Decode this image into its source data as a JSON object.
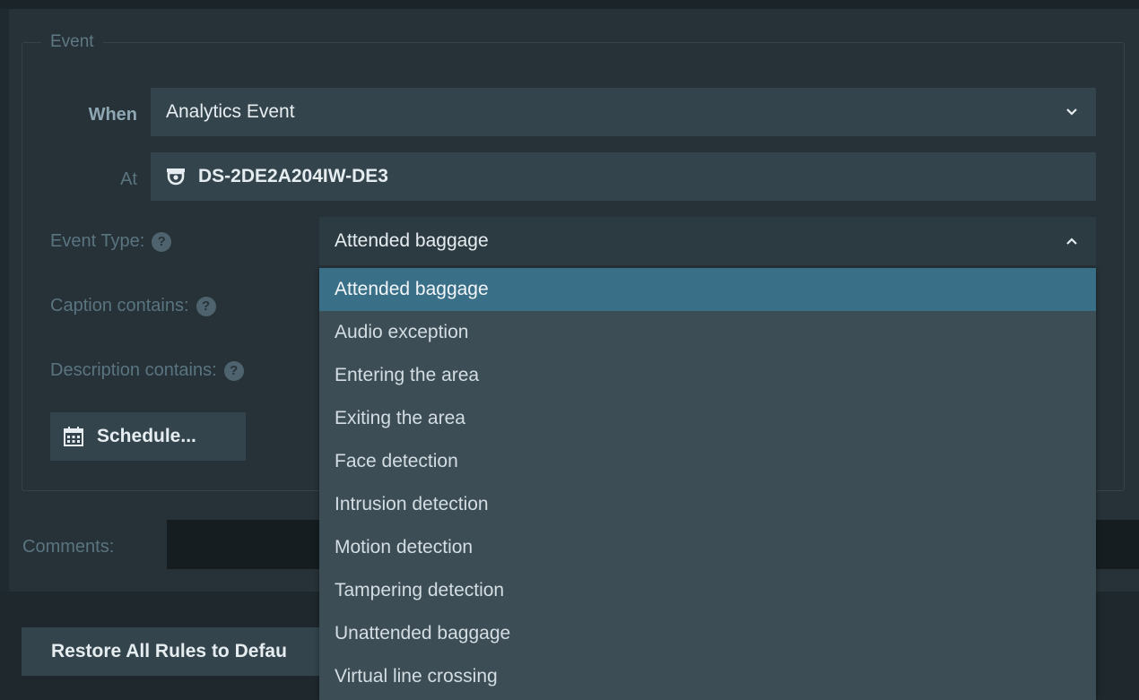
{
  "event_group": {
    "title": "Event"
  },
  "when": {
    "label": "When",
    "value": "Analytics Event"
  },
  "at": {
    "label": "At",
    "value": "DS-2DE2A204IW-DE3",
    "icon": "camera-icon"
  },
  "event_type": {
    "label": "Event Type:",
    "value": "Attended baggage",
    "expanded": true
  },
  "caption": {
    "label": "Caption contains:"
  },
  "description": {
    "label": "Description contains:"
  },
  "help_icon_glyph": "?",
  "schedule": {
    "label": "Schedule...",
    "icon": "calendar-icon"
  },
  "comments": {
    "label": "Comments:",
    "value": ""
  },
  "restore": {
    "label": "Restore All Rules to Defau"
  },
  "dropdown": {
    "selected_index": 0,
    "options": [
      "Attended baggage",
      "Audio exception",
      "Entering the area",
      "Exiting the area",
      "Face detection",
      "Intrusion detection",
      "Motion detection",
      "Tampering detection",
      "Unattended baggage",
      "Virtual line crossing"
    ]
  },
  "colors": {
    "background": "#263238",
    "field": "#34444d",
    "dropdown": "#3c4d56",
    "selected": "#3a6f88"
  }
}
